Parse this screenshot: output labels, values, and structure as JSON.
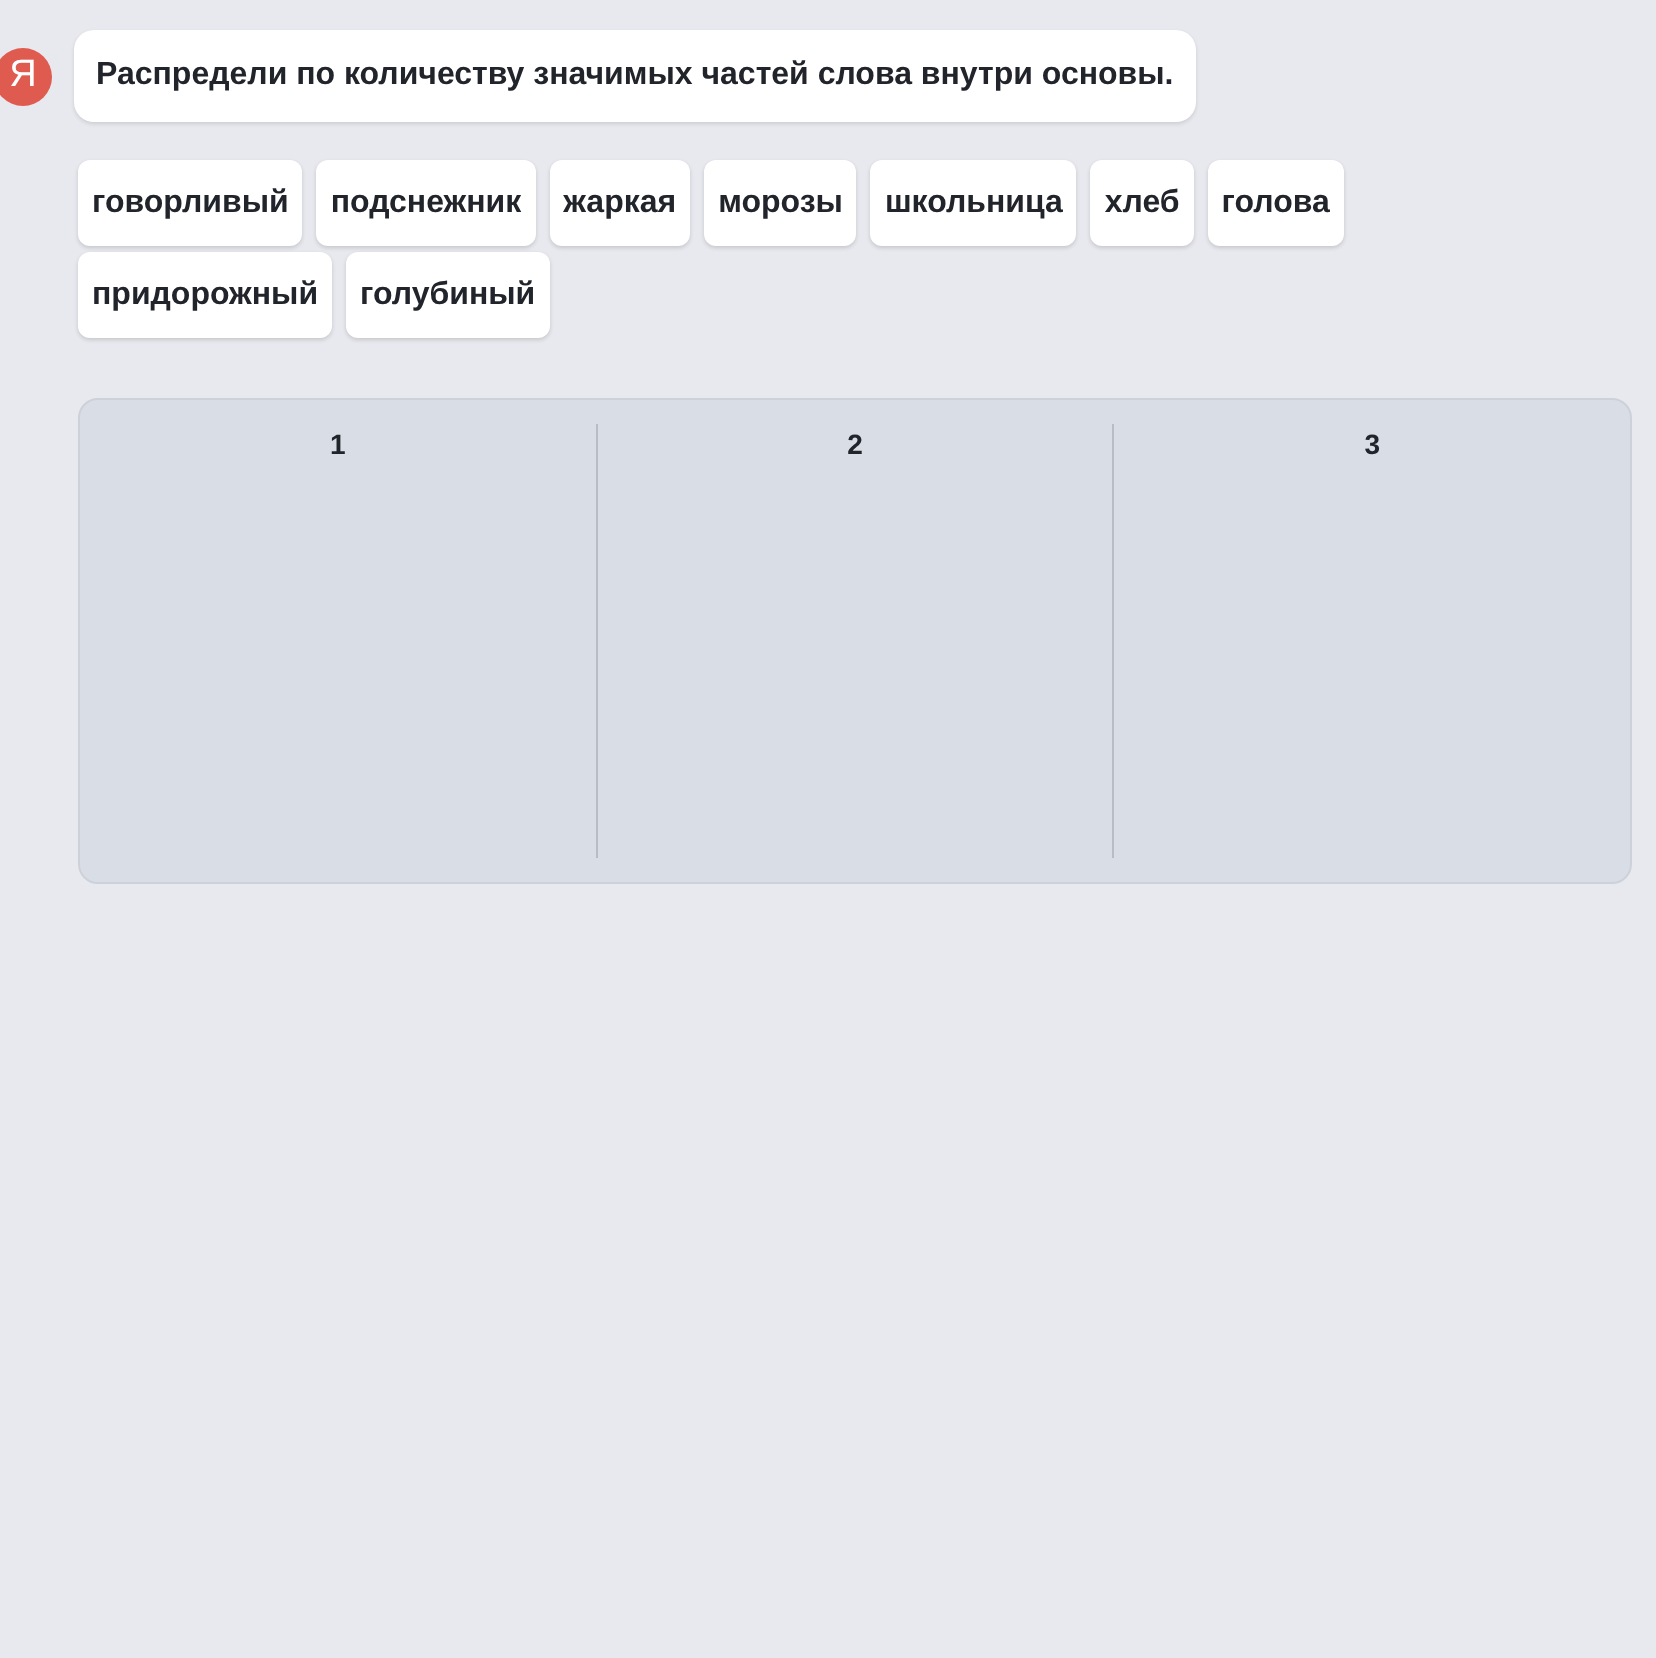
{
  "avatar_letter": "Я",
  "prompt": "Распредели по количеству значимых частей слова внутри основы.",
  "words": [
    "говорливый",
    "подснежник",
    "жаркая",
    "морозы",
    "школьница",
    "хлеб",
    "голова",
    "придорожный",
    "голубиный"
  ],
  "columns": [
    {
      "label": "1"
    },
    {
      "label": "2"
    },
    {
      "label": "3"
    }
  ]
}
